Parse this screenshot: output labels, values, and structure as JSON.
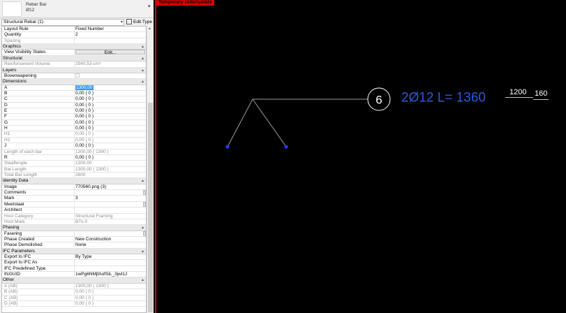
{
  "type_selector": {
    "name": "Rebar Bar",
    "size": "Ø12"
  },
  "instance_selector": {
    "value": "Structural Rebar (1)",
    "edit_type_label": "Edit Type"
  },
  "properties": [
    {
      "kind": "row",
      "name": "Layout Rule",
      "value": "Fixed Number"
    },
    {
      "kind": "row",
      "name": "Quantity",
      "value": "2"
    },
    {
      "kind": "row",
      "name": "Spacing",
      "value": "",
      "readonly": true
    },
    {
      "kind": "group",
      "name": "Graphics"
    },
    {
      "kind": "row",
      "name": "View Visibility States",
      "value": "Edit...",
      "button": true
    },
    {
      "kind": "group",
      "name": "Structural"
    },
    {
      "kind": "row",
      "name": "Reinforcement Volume",
      "value": "2940,53 cm³",
      "readonly": true
    },
    {
      "kind": "group",
      "name": "Layers"
    },
    {
      "kind": "row",
      "name": "Bovenwapening",
      "value": "",
      "checkbox": true
    },
    {
      "kind": "group",
      "name": "Dimensions"
    },
    {
      "kind": "row",
      "name": "A",
      "value": "1300,00",
      "selected": true
    },
    {
      "kind": "row",
      "name": "B",
      "value": "0,00 ( 0 )"
    },
    {
      "kind": "row",
      "name": "C",
      "value": "0,00 ( 0 )"
    },
    {
      "kind": "row",
      "name": "D",
      "value": "0,00 ( 0 )"
    },
    {
      "kind": "row",
      "name": "E",
      "value": "0,00 ( 0 )"
    },
    {
      "kind": "row",
      "name": "F",
      "value": "0,00 ( 0 )"
    },
    {
      "kind": "row",
      "name": "G",
      "value": "0,00 ( 0 )"
    },
    {
      "kind": "row",
      "name": "H",
      "value": "0,00 ( 0 )"
    },
    {
      "kind": "row",
      "name": "H1",
      "value": "0,00 ( 0 )",
      "readonly": true
    },
    {
      "kind": "row",
      "name": "H2",
      "value": "0,00 ( 0 )",
      "readonly": true
    },
    {
      "kind": "row",
      "name": "J",
      "value": "0,00 ( 0 )"
    },
    {
      "kind": "row",
      "name": "Length of each bar",
      "value": "1300,00 ( 1300 )",
      "readonly": true
    },
    {
      "kind": "row",
      "name": "R",
      "value": "0,00 ( 0 )"
    },
    {
      "kind": "row",
      "name": "Staaflengte",
      "value": "1300,00",
      "readonly": true
    },
    {
      "kind": "row",
      "name": "Bar Length",
      "value": "1300,00 ( 1300 )",
      "readonly": true
    },
    {
      "kind": "row",
      "name": "Total Bar Length",
      "value": "2600",
      "readonly": true
    },
    {
      "kind": "group",
      "name": "Identity Data"
    },
    {
      "kind": "row",
      "name": "Image",
      "value": "770560.png (3)"
    },
    {
      "kind": "row",
      "name": "Comments",
      "value": "",
      "field_button": true
    },
    {
      "kind": "row",
      "name": "Mark",
      "value": "3"
    },
    {
      "kind": "row",
      "name": "Meetstaat",
      "value": "",
      "field_button": true
    },
    {
      "kind": "row",
      "name": "Architect",
      "value": ""
    },
    {
      "kind": "row",
      "name": "Host Category",
      "value": "Structural Framing",
      "readonly": true
    },
    {
      "kind": "row",
      "name": "Host Mark",
      "value": "BTx.0",
      "readonly": true
    },
    {
      "kind": "group",
      "name": "Phasing"
    },
    {
      "kind": "row",
      "name": "Fasering",
      "value": "",
      "field_button": true
    },
    {
      "kind": "row",
      "name": "Phase Created",
      "value": "New Construction"
    },
    {
      "kind": "row",
      "name": "Phase Demolished",
      "value": "None"
    },
    {
      "kind": "group",
      "name": "IFC Parameters"
    },
    {
      "kind": "row",
      "name": "Export to IFC",
      "value": "By Type"
    },
    {
      "kind": "row",
      "name": "Export to IFC As",
      "value": ""
    },
    {
      "kind": "row",
      "name": "IFC Predefined Type",
      "value": ""
    },
    {
      "kind": "row",
      "name": "IfcGUID",
      "value": "1wPg6NMjfAofSiL_3jwl1J"
    },
    {
      "kind": "group",
      "name": "Other"
    },
    {
      "kind": "row",
      "name": "A (AB)",
      "value": "1300,00 ( 1300 )",
      "readonly": true
    },
    {
      "kind": "row",
      "name": "B (AB)",
      "value": "0,00 ( 0 )",
      "readonly": true
    },
    {
      "kind": "row",
      "name": "C (AB)",
      "value": "0,00 ( 0 )",
      "readonly": true
    },
    {
      "kind": "row",
      "name": "D (AB)",
      "value": "0,00 ( 0 )",
      "readonly": true
    }
  ],
  "view": {
    "mode_banner": "Temporary Hide/Isolate",
    "tag": {
      "mark": "6",
      "label": "2Ø12 L= 1360",
      "dim_top": "1200",
      "dim_right": "160"
    },
    "colors": {
      "background": "#000000",
      "banner": "#e00000",
      "border": "#dd0000",
      "rebar_line": "#9a9a9a",
      "leader_dot": "#1e3cff",
      "tag_text": "#2b5bd8",
      "white": "#ffffff"
    }
  }
}
